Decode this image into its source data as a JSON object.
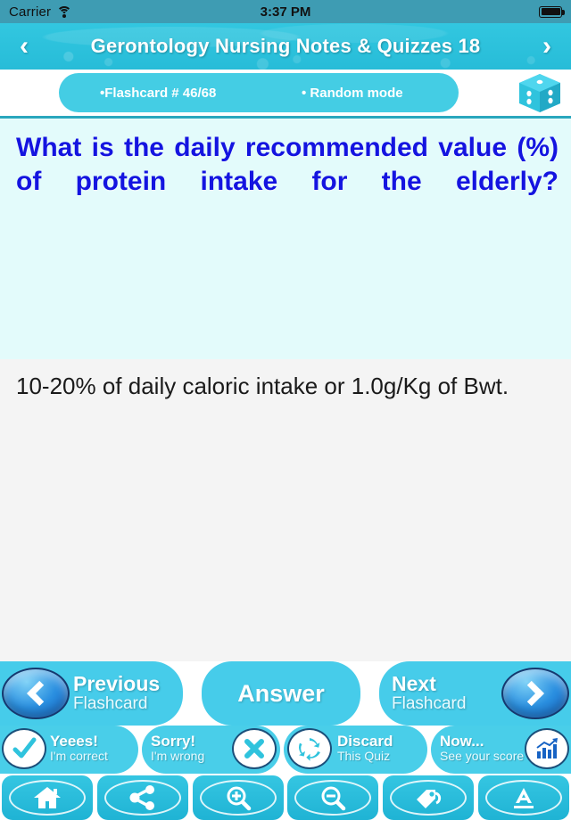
{
  "statusbar": {
    "carrier": "Carrier",
    "time": "3:37 PM",
    "wifi_icon": "wifi-icon",
    "battery_icon": "battery-full-icon"
  },
  "header": {
    "title": "Gerontology Nursing Notes & Quizzes 18",
    "prev_arrow": "‹",
    "next_arrow": "›"
  },
  "meta": {
    "flashcard_counter": "•Flashcard #  46/68",
    "mode": "• Random mode",
    "dice_icon": "dice-icon"
  },
  "question": {
    "text": "What is the daily recommended value (%) of protein intake for the elderly?"
  },
  "answer": {
    "text": "10-20% of daily caloric intake or 1.0g/Kg of Bwt."
  },
  "nav": {
    "previous_big": "Previous",
    "previous_small": "Flashcard",
    "answer_label": "Answer",
    "next_big": "Next",
    "next_small": "Flashcard"
  },
  "quiz_actions": [
    {
      "big": "Yeees!",
      "small": "I'm correct",
      "icon": "check-icon"
    },
    {
      "big": "Sorry!",
      "small": "I'm wrong",
      "icon": "cross-icon"
    },
    {
      "big": "Discard",
      "small": "This Quiz",
      "icon": "recycle-icon"
    },
    {
      "big": "Now...",
      "small": "See your score",
      "icon": "bar-chart-icon"
    }
  ],
  "toolbar": [
    {
      "icon": "home-icon"
    },
    {
      "icon": "share-icon"
    },
    {
      "icon": "zoom-in-icon"
    },
    {
      "icon": "zoom-out-icon"
    },
    {
      "icon": "bookmark-tag-icon"
    },
    {
      "icon": "font-size-icon"
    }
  ],
  "colors": {
    "cyan": "#2fc3dd",
    "pill": "#44cde4",
    "question_bg": "#e3fbfb",
    "question_text": "#1414e0",
    "answer_bg": "#f4f4f4",
    "statusbar_bg": "#3e9cb3"
  }
}
